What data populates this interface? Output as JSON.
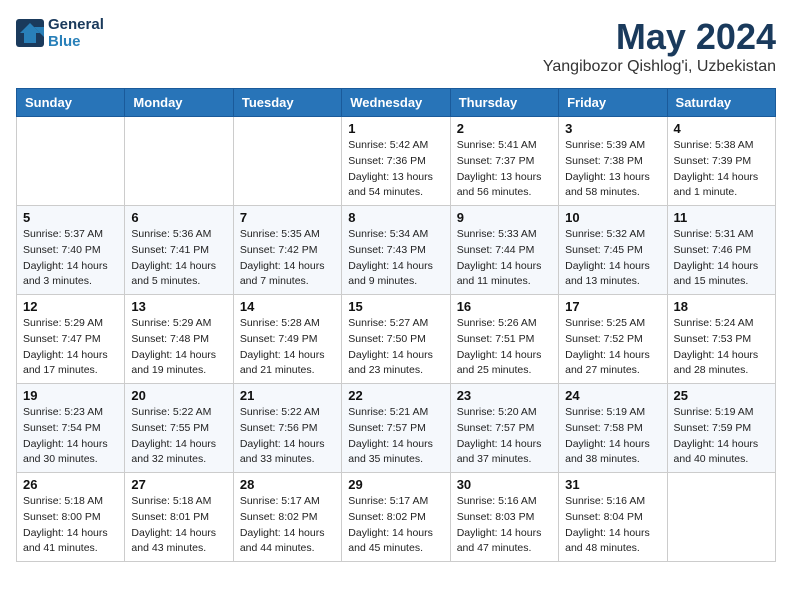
{
  "logo": {
    "line1": "General",
    "line2": "Blue"
  },
  "title": "May 2024",
  "location": "Yangibozor Qishlog'i, Uzbekistan",
  "days_of_week": [
    "Sunday",
    "Monday",
    "Tuesday",
    "Wednesday",
    "Thursday",
    "Friday",
    "Saturday"
  ],
  "weeks": [
    [
      {
        "day": "",
        "info": ""
      },
      {
        "day": "",
        "info": ""
      },
      {
        "day": "",
        "info": ""
      },
      {
        "day": "1",
        "info": "Sunrise: 5:42 AM\nSunset: 7:36 PM\nDaylight: 13 hours\nand 54 minutes."
      },
      {
        "day": "2",
        "info": "Sunrise: 5:41 AM\nSunset: 7:37 PM\nDaylight: 13 hours\nand 56 minutes."
      },
      {
        "day": "3",
        "info": "Sunrise: 5:39 AM\nSunset: 7:38 PM\nDaylight: 13 hours\nand 58 minutes."
      },
      {
        "day": "4",
        "info": "Sunrise: 5:38 AM\nSunset: 7:39 PM\nDaylight: 14 hours\nand 1 minute."
      }
    ],
    [
      {
        "day": "5",
        "info": "Sunrise: 5:37 AM\nSunset: 7:40 PM\nDaylight: 14 hours\nand 3 minutes."
      },
      {
        "day": "6",
        "info": "Sunrise: 5:36 AM\nSunset: 7:41 PM\nDaylight: 14 hours\nand 5 minutes."
      },
      {
        "day": "7",
        "info": "Sunrise: 5:35 AM\nSunset: 7:42 PM\nDaylight: 14 hours\nand 7 minutes."
      },
      {
        "day": "8",
        "info": "Sunrise: 5:34 AM\nSunset: 7:43 PM\nDaylight: 14 hours\nand 9 minutes."
      },
      {
        "day": "9",
        "info": "Sunrise: 5:33 AM\nSunset: 7:44 PM\nDaylight: 14 hours\nand 11 minutes."
      },
      {
        "day": "10",
        "info": "Sunrise: 5:32 AM\nSunset: 7:45 PM\nDaylight: 14 hours\nand 13 minutes."
      },
      {
        "day": "11",
        "info": "Sunrise: 5:31 AM\nSunset: 7:46 PM\nDaylight: 14 hours\nand 15 minutes."
      }
    ],
    [
      {
        "day": "12",
        "info": "Sunrise: 5:29 AM\nSunset: 7:47 PM\nDaylight: 14 hours\nand 17 minutes."
      },
      {
        "day": "13",
        "info": "Sunrise: 5:29 AM\nSunset: 7:48 PM\nDaylight: 14 hours\nand 19 minutes."
      },
      {
        "day": "14",
        "info": "Sunrise: 5:28 AM\nSunset: 7:49 PM\nDaylight: 14 hours\nand 21 minutes."
      },
      {
        "day": "15",
        "info": "Sunrise: 5:27 AM\nSunset: 7:50 PM\nDaylight: 14 hours\nand 23 minutes."
      },
      {
        "day": "16",
        "info": "Sunrise: 5:26 AM\nSunset: 7:51 PM\nDaylight: 14 hours\nand 25 minutes."
      },
      {
        "day": "17",
        "info": "Sunrise: 5:25 AM\nSunset: 7:52 PM\nDaylight: 14 hours\nand 27 minutes."
      },
      {
        "day": "18",
        "info": "Sunrise: 5:24 AM\nSunset: 7:53 PM\nDaylight: 14 hours\nand 28 minutes."
      }
    ],
    [
      {
        "day": "19",
        "info": "Sunrise: 5:23 AM\nSunset: 7:54 PM\nDaylight: 14 hours\nand 30 minutes."
      },
      {
        "day": "20",
        "info": "Sunrise: 5:22 AM\nSunset: 7:55 PM\nDaylight: 14 hours\nand 32 minutes."
      },
      {
        "day": "21",
        "info": "Sunrise: 5:22 AM\nSunset: 7:56 PM\nDaylight: 14 hours\nand 33 minutes."
      },
      {
        "day": "22",
        "info": "Sunrise: 5:21 AM\nSunset: 7:57 PM\nDaylight: 14 hours\nand 35 minutes."
      },
      {
        "day": "23",
        "info": "Sunrise: 5:20 AM\nSunset: 7:57 PM\nDaylight: 14 hours\nand 37 minutes."
      },
      {
        "day": "24",
        "info": "Sunrise: 5:19 AM\nSunset: 7:58 PM\nDaylight: 14 hours\nand 38 minutes."
      },
      {
        "day": "25",
        "info": "Sunrise: 5:19 AM\nSunset: 7:59 PM\nDaylight: 14 hours\nand 40 minutes."
      }
    ],
    [
      {
        "day": "26",
        "info": "Sunrise: 5:18 AM\nSunset: 8:00 PM\nDaylight: 14 hours\nand 41 minutes."
      },
      {
        "day": "27",
        "info": "Sunrise: 5:18 AM\nSunset: 8:01 PM\nDaylight: 14 hours\nand 43 minutes."
      },
      {
        "day": "28",
        "info": "Sunrise: 5:17 AM\nSunset: 8:02 PM\nDaylight: 14 hours\nand 44 minutes."
      },
      {
        "day": "29",
        "info": "Sunrise: 5:17 AM\nSunset: 8:02 PM\nDaylight: 14 hours\nand 45 minutes."
      },
      {
        "day": "30",
        "info": "Sunrise: 5:16 AM\nSunset: 8:03 PM\nDaylight: 14 hours\nand 47 minutes."
      },
      {
        "day": "31",
        "info": "Sunrise: 5:16 AM\nSunset: 8:04 PM\nDaylight: 14 hours\nand 48 minutes."
      },
      {
        "day": "",
        "info": ""
      }
    ]
  ]
}
